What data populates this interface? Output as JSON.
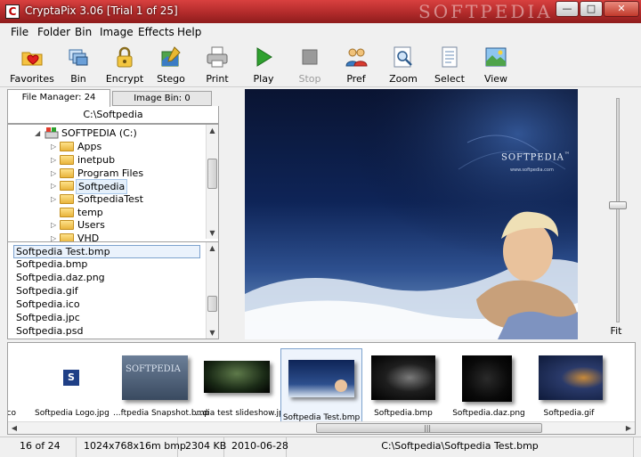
{
  "window": {
    "title": "CryptaPix 3.06  [Trial 1 of 25]",
    "watermark": "SOFTPEDIA",
    "controls": {
      "minimize": "—",
      "maximize": "□",
      "close": "✕"
    }
  },
  "menu": [
    "File",
    "Folder",
    "Bin",
    "Image",
    "Effects",
    "Help"
  ],
  "toolbar": {
    "buttons": [
      {
        "label": "Favorites",
        "icon": "favorites-icon"
      },
      {
        "label": "Bin",
        "icon": "bin-icon"
      },
      {
        "label": "Encrypt",
        "icon": "lock-icon"
      },
      {
        "label": "Stego",
        "icon": "stego-icon"
      },
      {
        "label": "Print",
        "icon": "printer-icon"
      },
      {
        "label": "Play",
        "icon": "play-icon"
      },
      {
        "label": "Stop",
        "icon": "stop-icon",
        "disabled": true
      },
      {
        "label": "Pref",
        "icon": "users-icon"
      },
      {
        "label": "Zoom",
        "icon": "zoom-icon"
      },
      {
        "label": "Select",
        "icon": "select-icon"
      },
      {
        "label": "View",
        "icon": "view-icon"
      }
    ]
  },
  "tabs": {
    "file_manager": "File Manager: 24",
    "image_bin": "Image Bin: 0"
  },
  "current_path": "C:\\Softpedia",
  "tree": {
    "drive": "SOFTPEDIA (C:)",
    "folders": [
      "Apps",
      "inetpub",
      "Program Files",
      "Softpedia",
      "SoftpediaTest",
      "temp",
      "Users",
      "VHD"
    ],
    "selected": "Softpedia"
  },
  "files": {
    "items": [
      "Softpedia Test.bmp",
      "Softpedia.bmp",
      "Softpedia.daz.png",
      "Softpedia.gif",
      "Softpedia.ico",
      "Softpedia.jpc",
      "Softpedia.psd"
    ],
    "selected": "Softpedia Test.bmp"
  },
  "preview": {
    "brand": "SOFTPEDIA",
    "trademark": "™",
    "site": "www.softpedia.com"
  },
  "fit_label": "Fit",
  "thumbnails": [
    {
      "caption": "ico"
    },
    {
      "caption": "Softpedia Logo.jpg"
    },
    {
      "caption": "...ftpedia Snapshot.bmp"
    },
    {
      "caption": "...dia test slideshow.jpg"
    },
    {
      "caption": "Softpedia Test.bmp",
      "selected": true
    },
    {
      "caption": "Softpedia.bmp"
    },
    {
      "caption": "Softpedia.daz.png"
    },
    {
      "caption": "Softpedia.gif"
    }
  ],
  "thumb_logo_letter": "S",
  "thumb_snapshot_text": "SOFTPEDIA",
  "status": {
    "index": "16 of 24",
    "dimensions": "1024x768x16m bmp",
    "size": "2304 KB",
    "date": "2010-06-28",
    "path": "C:\\Softpedia\\Softpedia Test.bmp"
  },
  "colors": {
    "titlebar": "#b22b2b",
    "selection": "#a8c7ea",
    "play_green": "#2fa12f"
  }
}
